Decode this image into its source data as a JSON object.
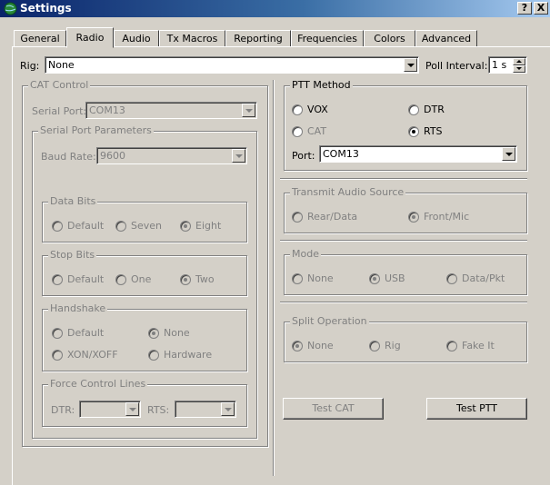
{
  "window": {
    "title": "Settings",
    "help_label": "?",
    "close_label": "X"
  },
  "tabs": [
    "General",
    "Radio",
    "Audio",
    "Tx Macros",
    "Reporting",
    "Frequencies",
    "Colors",
    "Advanced"
  ],
  "active_tab": "Radio",
  "rig": {
    "label": "Rig:",
    "value": "None"
  },
  "poll": {
    "label": "Poll Interval:",
    "value": "1 s"
  },
  "cat": {
    "title": "CAT Control",
    "serial_port_label": "Serial Port:",
    "serial_port_value": "COM13",
    "params_title": "Serial Port Parameters",
    "baud_label": "Baud Rate:",
    "baud_value": "9600",
    "data_bits": {
      "title": "Data Bits",
      "options": [
        "Default",
        "Seven",
        "Eight"
      ],
      "selected": "Eight"
    },
    "stop_bits": {
      "title": "Stop Bits",
      "options": [
        "Default",
        "One",
        "Two"
      ],
      "selected": "Two"
    },
    "handshake": {
      "title": "Handshake",
      "options": [
        "Default",
        "None",
        "XON/XOFF",
        "Hardware"
      ],
      "selected": "None"
    },
    "force": {
      "title": "Force Control Lines",
      "dtr_label": "DTR:",
      "rts_label": "RTS:"
    }
  },
  "ptt": {
    "title": "PTT Method",
    "options": [
      "VOX",
      "DTR",
      "CAT",
      "RTS"
    ],
    "selected": "RTS",
    "port_label": "Port:",
    "port_value": "COM13"
  },
  "tx_audio": {
    "title": "Transmit Audio Source",
    "options": [
      "Rear/Data",
      "Front/Mic"
    ],
    "selected": "Front/Mic"
  },
  "mode": {
    "title": "Mode",
    "options": [
      "None",
      "USB",
      "Data/Pkt"
    ],
    "selected": "USB"
  },
  "split": {
    "title": "Split Operation",
    "options": [
      "None",
      "Rig",
      "Fake It"
    ],
    "selected": "None"
  },
  "buttons": {
    "test_cat": "Test CAT",
    "test_ptt": "Test PTT"
  }
}
